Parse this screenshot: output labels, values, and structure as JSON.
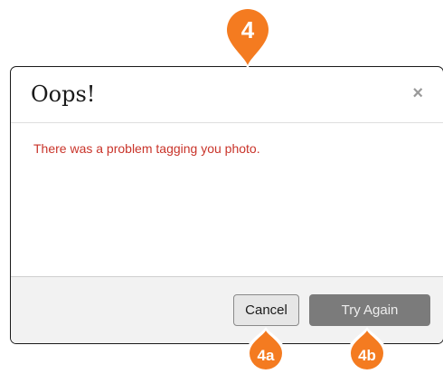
{
  "dialog": {
    "title": "Oops!",
    "close_glyph": "×",
    "message": "There was a problem tagging you photo.",
    "message_color": "#c9342a",
    "cancel_label": "Cancel",
    "try_again_label": "Try Again"
  },
  "markers": {
    "main": "4",
    "cancel": "4a",
    "try_again": "4b",
    "color": "#f47b20"
  },
  "icons": {
    "close": "close-icon"
  }
}
